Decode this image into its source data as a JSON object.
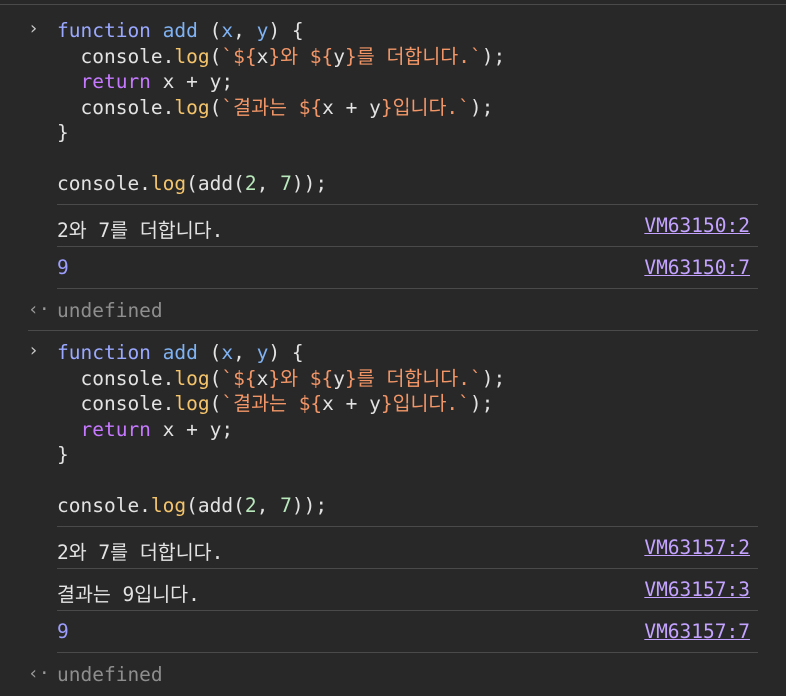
{
  "prompt_glyph": "›",
  "return_glyph": "‹·",
  "block1": {
    "code": [
      [
        [
          "kw-fn",
          "function"
        ],
        [
          "plain",
          " "
        ],
        [
          "fname",
          "add"
        ],
        [
          "plain",
          " ("
        ],
        [
          "param",
          "x"
        ],
        [
          "plain",
          ", "
        ],
        [
          "param",
          "y"
        ],
        [
          "plain",
          ") {"
        ]
      ],
      [
        [
          "plain",
          "  console."
        ],
        [
          "method",
          "log"
        ],
        [
          "plain",
          "("
        ],
        [
          "str",
          "`${"
        ],
        [
          "plain",
          "x"
        ],
        [
          "str",
          "}와 ${"
        ],
        [
          "plain",
          "y"
        ],
        [
          "str",
          "}를 더합니다.`"
        ],
        [
          "plain",
          ");"
        ]
      ],
      [
        [
          "plain",
          "  "
        ],
        [
          "kw",
          "return"
        ],
        [
          "plain",
          " x + y;"
        ]
      ],
      [
        [
          "plain",
          "  console."
        ],
        [
          "method",
          "log"
        ],
        [
          "plain",
          "("
        ],
        [
          "str",
          "`결과는 ${"
        ],
        [
          "plain",
          "x + y"
        ],
        [
          "str",
          "}입니다.`"
        ],
        [
          "plain",
          ");"
        ]
      ],
      [
        [
          "plain",
          "}"
        ]
      ],
      [
        [
          "plain",
          ""
        ]
      ],
      [
        [
          "plain",
          "console."
        ],
        [
          "method",
          "log"
        ],
        [
          "plain",
          "(add("
        ],
        [
          "num",
          "2"
        ],
        [
          "plain",
          ", "
        ],
        [
          "num",
          "7"
        ],
        [
          "plain",
          "));"
        ]
      ]
    ],
    "outputs": [
      {
        "text": "2와 7를 더합니다.",
        "kind": "text",
        "source": "VM63150:2"
      },
      {
        "text": "9",
        "kind": "number",
        "source": "VM63150:7"
      }
    ],
    "result": "undefined"
  },
  "block2": {
    "code": [
      [
        [
          "kw-fn",
          "function"
        ],
        [
          "plain",
          " "
        ],
        [
          "fname",
          "add"
        ],
        [
          "plain",
          " ("
        ],
        [
          "param",
          "x"
        ],
        [
          "plain",
          ", "
        ],
        [
          "param",
          "y"
        ],
        [
          "plain",
          ") {"
        ]
      ],
      [
        [
          "plain",
          "  console."
        ],
        [
          "method",
          "log"
        ],
        [
          "plain",
          "("
        ],
        [
          "str",
          "`${"
        ],
        [
          "plain",
          "x"
        ],
        [
          "str",
          "}와 ${"
        ],
        [
          "plain",
          "y"
        ],
        [
          "str",
          "}를 더합니다.`"
        ],
        [
          "plain",
          ");"
        ]
      ],
      [
        [
          "plain",
          "  console."
        ],
        [
          "method",
          "log"
        ],
        [
          "plain",
          "("
        ],
        [
          "str",
          "`결과는 ${"
        ],
        [
          "plain",
          "x + y"
        ],
        [
          "str",
          "}입니다.`"
        ],
        [
          "plain",
          ");"
        ]
      ],
      [
        [
          "plain",
          "  "
        ],
        [
          "kw",
          "return"
        ],
        [
          "plain",
          " x + y;"
        ]
      ],
      [
        [
          "plain",
          "}"
        ]
      ],
      [
        [
          "plain",
          ""
        ]
      ],
      [
        [
          "plain",
          "console."
        ],
        [
          "method",
          "log"
        ],
        [
          "plain",
          "(add("
        ],
        [
          "num",
          "2"
        ],
        [
          "plain",
          ", "
        ],
        [
          "num",
          "7"
        ],
        [
          "plain",
          "));"
        ]
      ]
    ],
    "outputs": [
      {
        "text": "2와 7를 더합니다.",
        "kind": "text",
        "source": "VM63157:2"
      },
      {
        "text": "결과는 9입니다.",
        "kind": "text",
        "source": "VM63157:3"
      },
      {
        "text": "9",
        "kind": "number",
        "source": "VM63157:7"
      }
    ],
    "result": "undefined"
  }
}
